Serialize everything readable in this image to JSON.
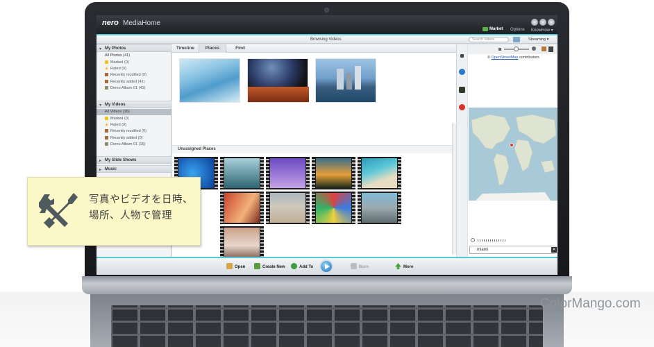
{
  "window": {
    "brand": "nero",
    "app_name": "MediaHome",
    "menu": [
      "Market",
      "Options",
      "KnowHow ▾"
    ],
    "toolbar_title": "Browsing Videos",
    "search_placeholder": "Search Videos",
    "streaming_label": "Streaming ▾"
  },
  "sidebar": {
    "photos": {
      "heading": "My Photos",
      "all": "All Photos (41)",
      "items": [
        "Marked (0)",
        "Rated (0)",
        "Recently modified (0)",
        "Recently added (41)",
        "Demo Album 01 (41)"
      ]
    },
    "videos": {
      "heading": "My Videos",
      "all": "All Videos (16)",
      "items": [
        "Marked (0)",
        "Rated (0)",
        "Recently modified (0)",
        "Recently added (0)",
        "Demo Album 01 (16)"
      ]
    },
    "slideshows": "My Slide Shows",
    "music": "Music"
  },
  "tabs": [
    "Timeline",
    "Places",
    "Find"
  ],
  "unassigned_heading": "Unassigned Places",
  "map": {
    "attribution_prefix": "©",
    "attribution_link": "OpenStreetMap",
    "attribution_suffix": "contributors",
    "search_value": "miami",
    "clear": "✕"
  },
  "bottom": {
    "buttons": [
      "Open",
      "Create New",
      "Add To",
      "Burn",
      "More"
    ]
  },
  "callout": {
    "line1": "写真やビデオを日時、",
    "line2": "場所、人物で管理"
  },
  "watermark": "ColorMango.com",
  "colors": {
    "accent": "#56c7d6",
    "callout_bg": "#fbf7c6"
  }
}
